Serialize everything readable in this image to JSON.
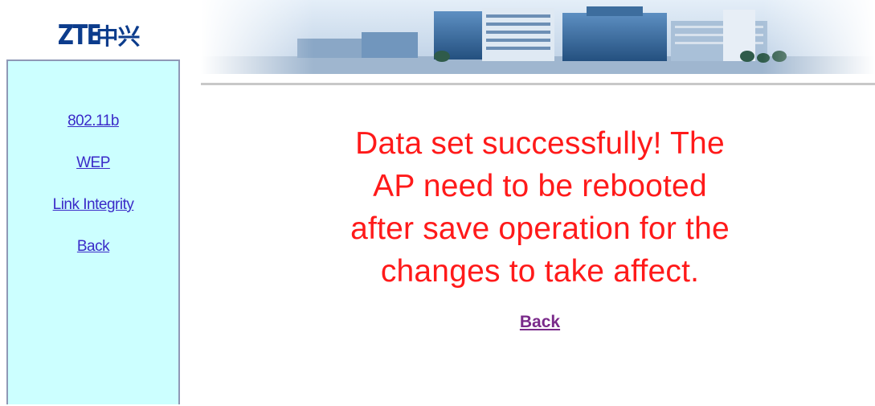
{
  "logo": {
    "latin": "ZTE",
    "cjk": "中兴"
  },
  "sidebar": {
    "background": "#ccffff",
    "link_color": "#3a2ac8",
    "items": [
      {
        "label": "802.11b"
      },
      {
        "label": "WEP"
      },
      {
        "label": "Link Integrity"
      },
      {
        "label": "Back"
      }
    ]
  },
  "main": {
    "message_lines": [
      "Data set successfully! The",
      "AP need to be rebooted",
      "after save operation for the",
      "changes to take affect."
    ],
    "message_color": "#ff1a1a",
    "back_link": "Back",
    "back_link_color": "#7a2a8a"
  },
  "banner": {
    "image": "office-buildings-banner"
  }
}
